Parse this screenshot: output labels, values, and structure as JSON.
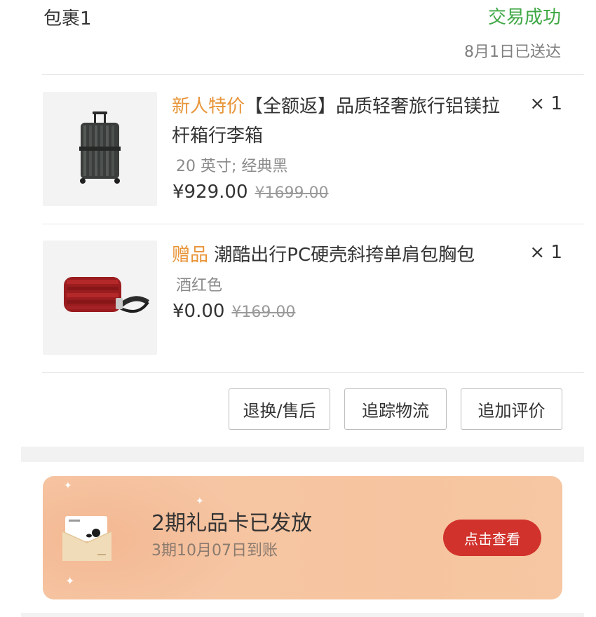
{
  "package": {
    "title": "包裹1",
    "status": "交易成功",
    "delivered": "8月1日已送达"
  },
  "items": [
    {
      "tag": "新人特价",
      "name": "【全额返】品质轻奢旅行铝镁拉杆箱行李箱",
      "qty": "× 1",
      "spec": "20 英寸; 经典黑",
      "price": "¥929.00",
      "original_price": "¥1699.00",
      "image_icon": "suitcase-icon"
    },
    {
      "tag": "赠品",
      "name": " 潮酷出行PC硬壳斜挎单肩包胸包",
      "qty": "× 1",
      "spec": "酒红色",
      "price": "¥0.00",
      "original_price": "¥169.00",
      "image_icon": "shoulder-bag-icon"
    }
  ],
  "actions": {
    "return": "退换/售后",
    "track": "追踪物流",
    "review": "追加评价"
  },
  "gift_card": {
    "title": "2期礼品卡已发放",
    "subtitle": "3期10月07日到账",
    "button": "点击查看",
    "icon": "gift-envelope-icon",
    "button_color": "#d1322c"
  },
  "colors": {
    "success": "#3fa845",
    "tag": "#e8953a"
  }
}
